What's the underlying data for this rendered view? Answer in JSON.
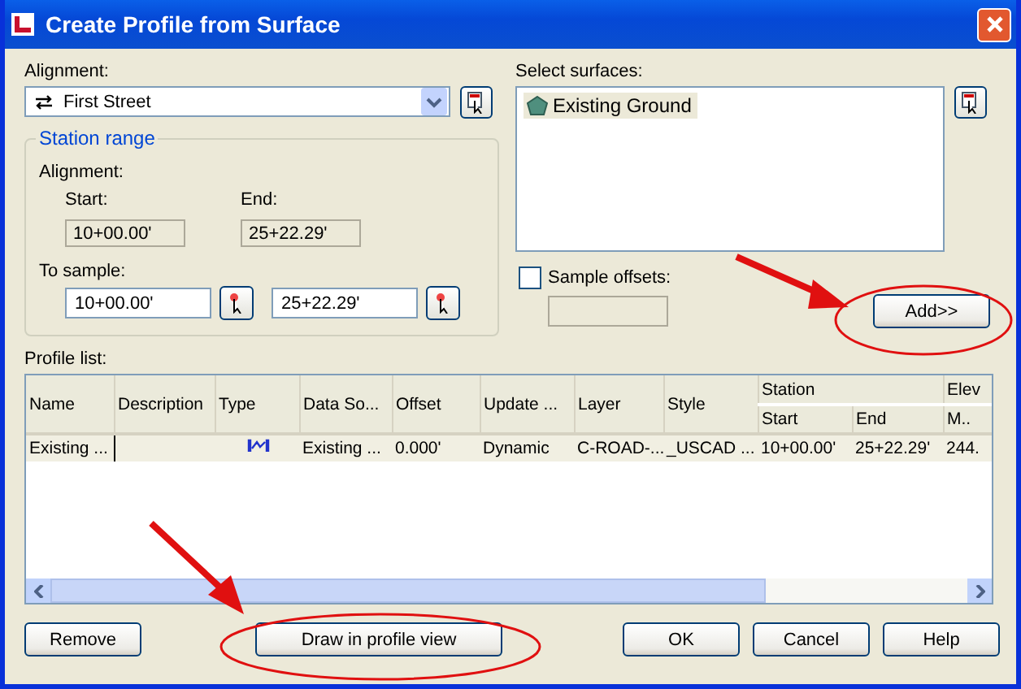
{
  "window": {
    "title": "Create Profile from Surface"
  },
  "alignment": {
    "label": "Alignment:",
    "value": "First Street"
  },
  "station_range": {
    "title": "Station range",
    "alignment_label": "Alignment:",
    "start_label": "Start:",
    "start_value": "10+00.00'",
    "end_label": "End:",
    "end_value": "25+22.29'",
    "to_sample_label": "To sample:",
    "sample_start": "10+00.00'",
    "sample_end": "25+22.29'"
  },
  "surfaces": {
    "label": "Select surfaces:",
    "items": [
      {
        "name": "Existing Ground",
        "selected": true
      }
    ]
  },
  "sample_offsets": {
    "label": "Sample offsets:",
    "checked": false
  },
  "add_button": "Add>>",
  "profile_list": {
    "label": "Profile list:",
    "columns": [
      {
        "label": "Name"
      },
      {
        "label": "Description"
      },
      {
        "label": "Type"
      },
      {
        "label": "Data So..."
      },
      {
        "label": "Offset"
      },
      {
        "label": "Update ..."
      },
      {
        "label": "Layer"
      },
      {
        "label": "Style"
      },
      {
        "label": "Station",
        "colspan": 2,
        "children": [
          {
            "label": "Start"
          },
          {
            "label": "End"
          }
        ]
      },
      {
        "label": "Elev",
        "children": [
          {
            "label": "M.."
          }
        ]
      }
    ],
    "rows": [
      {
        "selected": true,
        "cells": [
          {
            "kind": "text",
            "text": "Existing ..."
          },
          {
            "kind": "empty"
          },
          {
            "kind": "icon"
          },
          {
            "kind": "text",
            "text": "Existing ..."
          },
          {
            "kind": "text",
            "text": "0.000'"
          },
          {
            "kind": "text",
            "text": "Dynamic"
          },
          {
            "kind": "text",
            "text": "C-ROAD-..."
          },
          {
            "kind": "text",
            "text": "_USCAD ..."
          },
          {
            "kind": "text",
            "text": "10+00.00'"
          },
          {
            "kind": "text",
            "text": "25+22.29'"
          },
          {
            "kind": "text",
            "text": "244."
          }
        ]
      }
    ]
  },
  "buttons": {
    "remove": "Remove",
    "draw": "Draw in profile view",
    "ok": "OK",
    "cancel": "Cancel",
    "help": "Help"
  }
}
